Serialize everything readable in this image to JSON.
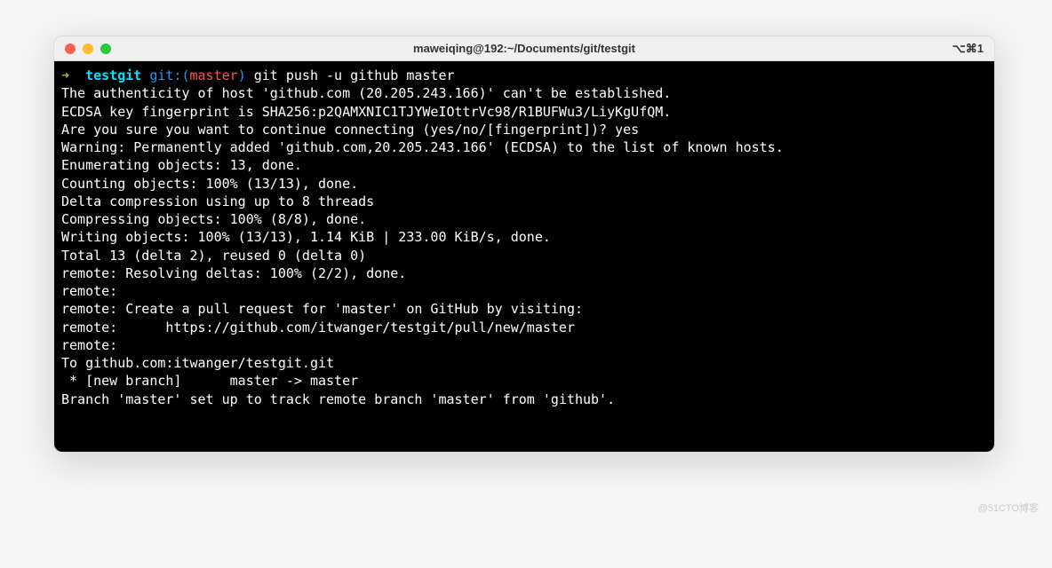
{
  "titlebar": {
    "title": "maweiqing@192:~/Documents/git/testgit",
    "shortcut": "⌥⌘1"
  },
  "prompt": {
    "arrow": "➜",
    "dir": "testgit",
    "git_label": "git:(",
    "branch": "master",
    "git_close": ")",
    "command": "git push -u github master"
  },
  "output": {
    "l1": "The authenticity of host 'github.com (20.205.243.166)' can't be established.",
    "l2": "ECDSA key fingerprint is SHA256:p2QAMXNIC1TJYWeIOttrVc98/R1BUFWu3/LiyKgUfQM.",
    "l3": "Are you sure you want to continue connecting (yes/no/[fingerprint])? yes",
    "l4": "Warning: Permanently added 'github.com,20.205.243.166' (ECDSA) to the list of known hosts.",
    "l5": "Enumerating objects: 13, done.",
    "l6": "Counting objects: 100% (13/13), done.",
    "l7": "Delta compression using up to 8 threads",
    "l8": "Compressing objects: 100% (8/8), done.",
    "l9": "Writing objects: 100% (13/13), 1.14 KiB | 233.00 KiB/s, done.",
    "l10": "Total 13 (delta 2), reused 0 (delta 0)",
    "l11": "remote: Resolving deltas: 100% (2/2), done.",
    "l12": "remote: ",
    "l13": "remote: Create a pull request for 'master' on GitHub by visiting:",
    "l14": "remote:      https://github.com/itwanger/testgit/pull/new/master",
    "l15": "remote: ",
    "l16": "To github.com:itwanger/testgit.git",
    "l17": " * [new branch]      master -> master",
    "l18": "Branch 'master' set up to track remote branch 'master' from 'github'."
  },
  "watermark": "@51CTO博客"
}
